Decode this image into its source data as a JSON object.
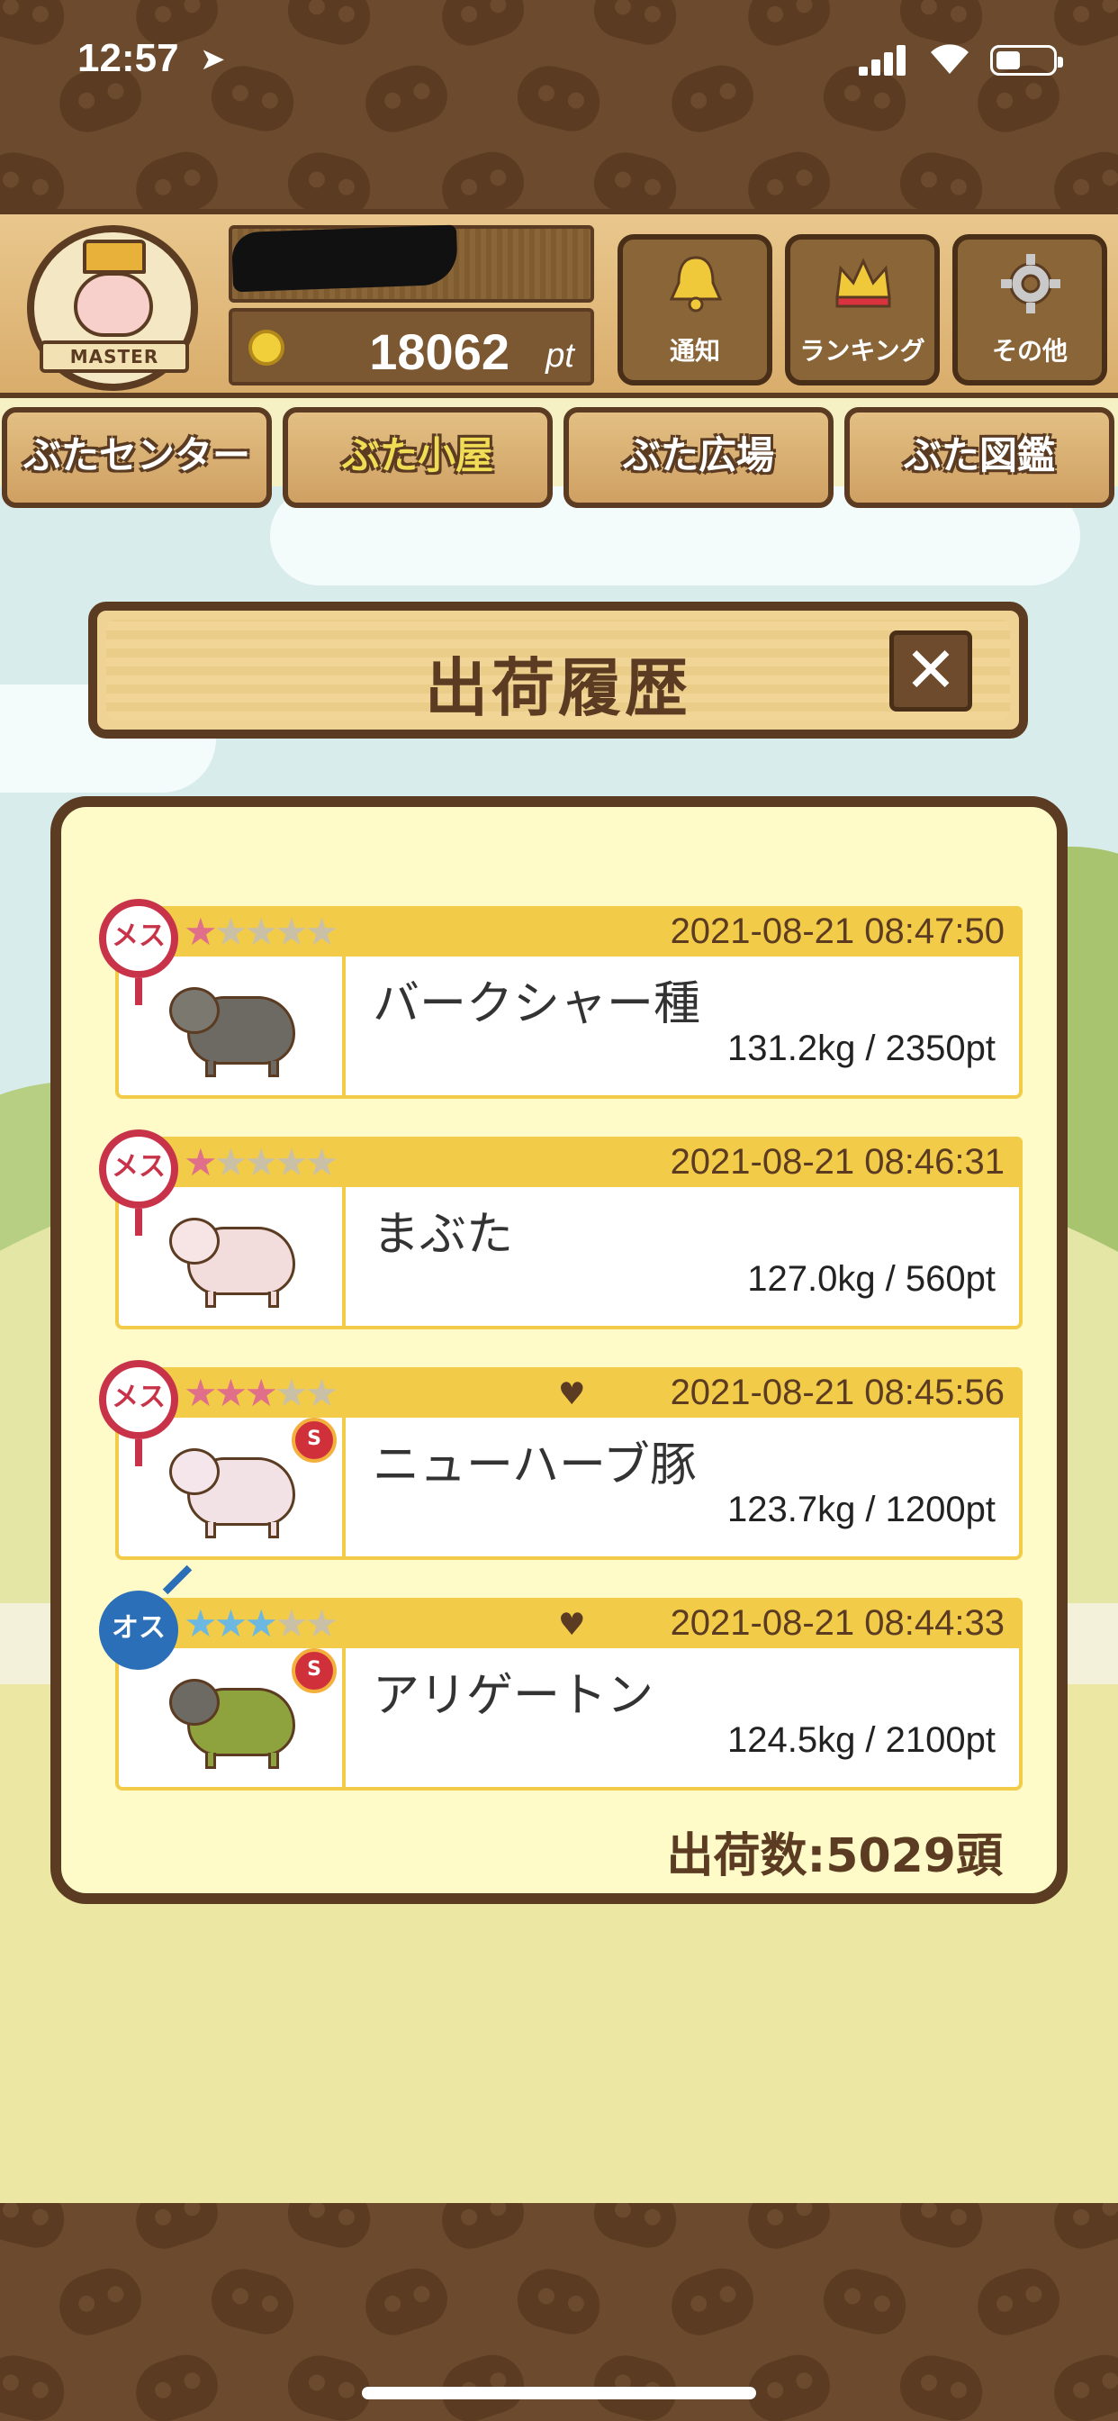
{
  "status_bar": {
    "time": "12:57",
    "location_arrow": "➤"
  },
  "header": {
    "avatar_banner": "MASTER",
    "points_value": "18062",
    "points_unit": "pt",
    "buttons": [
      {
        "label": "通知",
        "icon": "bell-icon"
      },
      {
        "label": "ランキング",
        "icon": "crown-icon"
      },
      {
        "label": "その他",
        "icon": "gear-icon"
      }
    ]
  },
  "tabs": [
    {
      "label": "ぶたセンター",
      "active": false
    },
    {
      "label": "ぶた小屋",
      "active": true
    },
    {
      "label": "ぶた広場",
      "active": false
    },
    {
      "label": "ぶた図鑑",
      "active": false
    }
  ],
  "modal": {
    "title": "出荷履歴",
    "close_label": "✕",
    "records": [
      {
        "gender": "メス",
        "stars": 1,
        "star_color": "#e0708a",
        "favorite": false,
        "award": false,
        "datetime": "2021-08-21 08:47:50",
        "name": "バークシャー種",
        "weight_pt": "131.2kg / 2350pt",
        "pig_color": "#6d6a63",
        "pig_head": "#7b7870"
      },
      {
        "gender": "メス",
        "stars": 1,
        "star_color": "#e0708a",
        "favorite": false,
        "award": false,
        "datetime": "2021-08-21 08:46:31",
        "name": "まぶた",
        "weight_pt": "127.0kg / 560pt",
        "pig_color": "#f3dcdc",
        "pig_head": "#f7e4e4"
      },
      {
        "gender": "メス",
        "stars": 3,
        "star_color": "#e0708a",
        "favorite": true,
        "award": true,
        "award_label": "S",
        "datetime": "2021-08-21 08:45:56",
        "name": "ニューハーブ豚",
        "weight_pt": "123.7kg / 1200pt",
        "pig_color": "#f2e2e6",
        "pig_head": "#f4e6ea"
      },
      {
        "gender": "オス",
        "stars": 3,
        "star_color": "#6cb8e0",
        "favorite": true,
        "award": true,
        "award_label": "S",
        "datetime": "2021-08-21 08:44:33",
        "name": "アリゲートン",
        "weight_pt": "124.5kg / 2100pt",
        "pig_color": "#8ea23e",
        "pig_head": "#6d6a63"
      }
    ],
    "total": "出荷数:5029頭"
  },
  "colors": {
    "brown_dark": "#5b3c22",
    "record_band": "#f2cc48",
    "modal_bg": "#fffbc9"
  }
}
